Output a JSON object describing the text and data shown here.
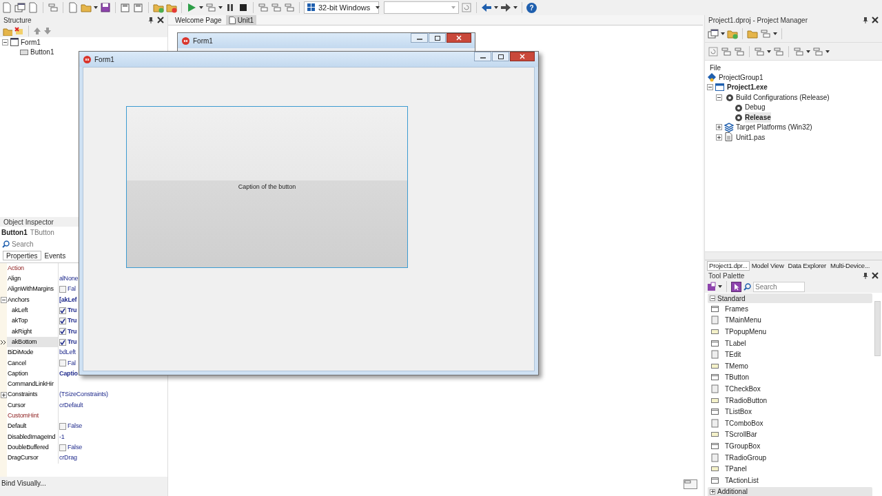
{
  "toolbar": {
    "platform": "32-bit Windows",
    "help": "?"
  },
  "structure": {
    "title": "Structure",
    "tree": [
      {
        "label": "Form1",
        "expanded": true,
        "selected": false,
        "children": [
          {
            "label": "Button1",
            "selected": false
          }
        ]
      }
    ]
  },
  "inspector": {
    "title": "Object Inspector",
    "object": "Button1",
    "object_class": "TButton",
    "search_placeholder": "Search",
    "tabs": [
      {
        "label": "Properties",
        "selected": true
      },
      {
        "label": "Events",
        "selected": false
      }
    ],
    "properties": [
      {
        "name": "Action",
        "kind": "text",
        "reference": true,
        "selected": false
      },
      {
        "name": "Align",
        "value": "alNone",
        "kind": "text",
        "reference": false,
        "selected": false
      },
      {
        "name": "AlignWithMargins",
        "value": "Fal",
        "kind": "check",
        "checked": false,
        "reference": false,
        "selected": false
      },
      {
        "name": "Anchors",
        "value": "[akLef",
        "kind": "bold",
        "reference": false,
        "selected": false,
        "expanded": true,
        "children": [
          {
            "name": "akLeft",
            "value": "Tru",
            "kind": "check",
            "checked": true,
            "reference": false,
            "selected": false
          },
          {
            "name": "akTop",
            "value": "Tru",
            "kind": "check",
            "checked": true,
            "reference": false,
            "selected": false
          },
          {
            "name": "akRight",
            "value": "Tru",
            "kind": "check",
            "checked": true,
            "reference": false,
            "selected": false
          },
          {
            "name": "akBottom",
            "value": "Tru",
            "kind": "check",
            "checked": true,
            "reference": false,
            "selected": true
          }
        ]
      },
      {
        "name": "BiDiMode",
        "value": "bdLeft",
        "kind": "text",
        "reference": false,
        "selected": false
      },
      {
        "name": "Cancel",
        "value": "Fal",
        "kind": "check",
        "checked": false,
        "reference": false,
        "selected": false
      },
      {
        "name": "Caption",
        "value": "Captio",
        "kind": "bold",
        "reference": false,
        "selected": false
      },
      {
        "name": "CommandLinkHir",
        "kind": "text",
        "reference": false,
        "selected": false
      },
      {
        "name": "Constraints",
        "value": "(TSizeConstraints)",
        "kind": "text",
        "reference": false,
        "selected": false,
        "expanded": false
      },
      {
        "name": "Cursor",
        "value": "crDefault",
        "kind": "text",
        "reference": false,
        "selected": false
      },
      {
        "name": "CustomHint",
        "kind": "text",
        "reference": true,
        "selected": false
      },
      {
        "name": "Default",
        "value": "False",
        "kind": "check",
        "checked": false,
        "reference": false,
        "selected": false
      },
      {
        "name": "DisabledImageInd",
        "value": "-1",
        "kind": "text",
        "reference": false,
        "selected": false
      },
      {
        "name": "DoubleBuffered",
        "value": "False",
        "kind": "check",
        "checked": false,
        "reference": false,
        "selected": false
      },
      {
        "name": "DragCursor",
        "value": "crDrag",
        "kind": "text",
        "reference": false,
        "selected": false
      }
    ],
    "footer": "Bind Visually..."
  },
  "editor": {
    "tabs": [
      {
        "label": "Welcome Page",
        "selected": false
      },
      {
        "label": "Unit1",
        "selected": true
      }
    ],
    "back_form": {
      "title": "Form1"
    },
    "form": {
      "title": "Form1",
      "button": "Caption of the button"
    }
  },
  "project_manager": {
    "title": "Project1.dproj - Project Manager",
    "column": "File",
    "tree": [
      {
        "label": "ProjectGroup1",
        "kind": "group",
        "bold": false,
        "selected": false
      },
      {
        "label": "Project1.exe",
        "kind": "project",
        "bold": true,
        "selected": false,
        "expanded": true,
        "children": [
          {
            "label": "Build Configurations (Release)",
            "kind": "configs",
            "bold": false,
            "selected": false,
            "expanded": true,
            "children": [
              {
                "label": "Debug",
                "kind": "config",
                "bold": false,
                "selected": false
              },
              {
                "label": "Release",
                "kind": "config",
                "bold": true,
                "selected": true
              }
            ]
          },
          {
            "label": "Target Platforms (Win32)",
            "kind": "platforms",
            "bold": false,
            "selected": false,
            "expanded": false
          },
          {
            "label": "Unit1.pas",
            "kind": "file",
            "bold": false,
            "selected": false,
            "expanded": false
          }
        ]
      }
    ],
    "tabs": [
      {
        "label": "Project1.dpr...",
        "selected": true
      },
      {
        "label": "Model View",
        "selected": false
      },
      {
        "label": "Data Explorer",
        "selected": false
      },
      {
        "label": "Multi-Device...",
        "selected": false
      }
    ]
  },
  "tool_palette": {
    "title": "Tool Palette",
    "search_placeholder": "Search",
    "groups": [
      {
        "label": "Standard",
        "expanded": true,
        "items": [
          "Frames",
          "TMainMenu",
          "TPopupMenu",
          "TLabel",
          "TEdit",
          "TMemo",
          "TButton",
          "TCheckBox",
          "TRadioButton",
          "TListBox",
          "TComboBox",
          "TScrollBar",
          "TGroupBox",
          "TRadioGroup",
          "TPanel",
          "TActionList"
        ]
      },
      {
        "label": "Additional",
        "expanded": false
      }
    ]
  }
}
